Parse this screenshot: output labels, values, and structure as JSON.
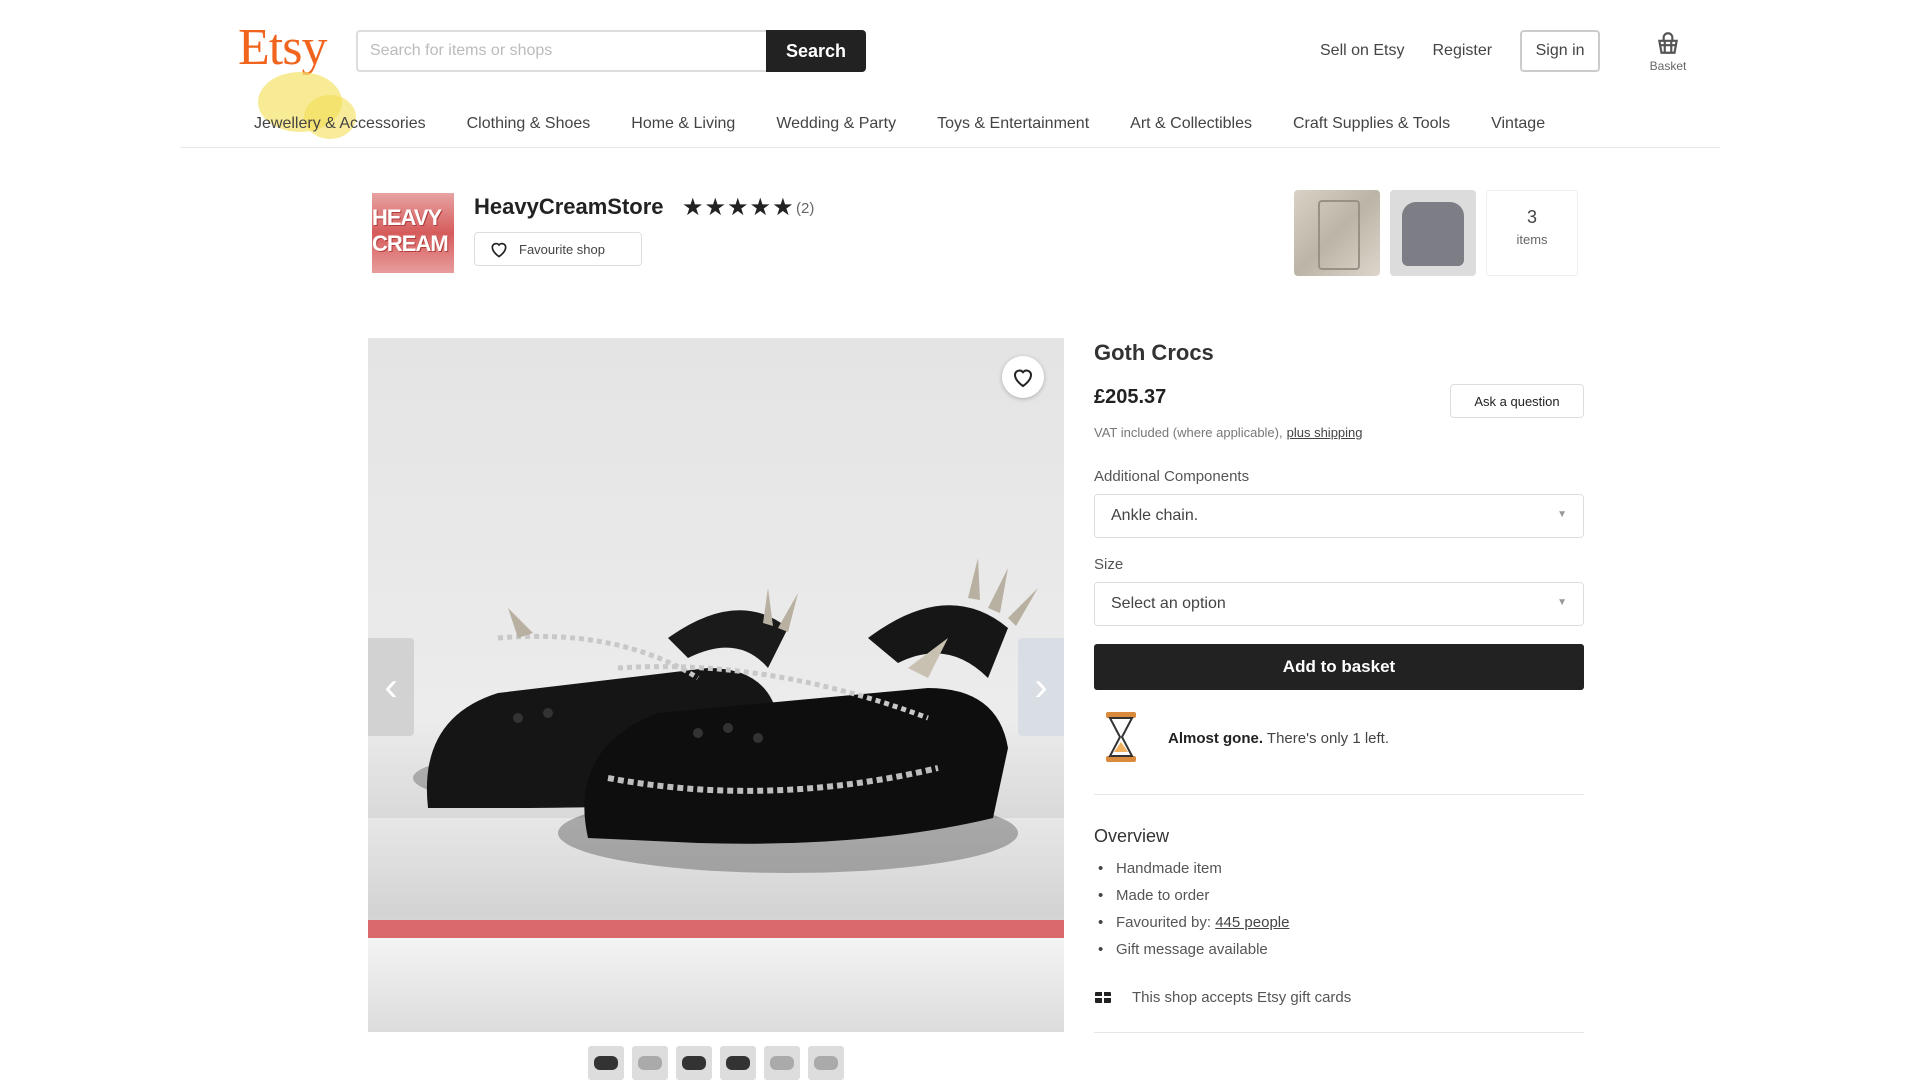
{
  "header": {
    "logo": "Etsy",
    "search": {
      "placeholder": "Search for items or shops",
      "button": "Search"
    },
    "links": {
      "sell": "Sell on Etsy",
      "register": "Register",
      "sign_in": "Sign in"
    },
    "basket_label": "Basket",
    "accent_color": "#f1641e"
  },
  "nav": {
    "items": [
      "Jewellery & Accessories",
      "Clothing & Shoes",
      "Home & Living",
      "Wedding & Party",
      "Toys & Entertainment",
      "Art & Collectibles",
      "Craft Supplies & Tools",
      "Vintage"
    ]
  },
  "shop": {
    "logo_lines": [
      "HEAVY",
      "CREAM"
    ],
    "name": "HeavyCreamStore",
    "stars": "★★★★★",
    "rating_count": "(2)",
    "favourite_label": "Favourite shop",
    "items_count": "3",
    "items_label": "items"
  },
  "product": {
    "title": "Goth Crocs",
    "price": "£205.37",
    "ask_question": "Ask a question",
    "vat_text": "VAT included (where applicable),",
    "vat_link": "plus shipping",
    "additional_components_label": "Additional Components",
    "additional_components_value": "Ankle chain.",
    "size_label": "Size",
    "size_value": "Select an option",
    "add_to_basket": "Add to basket",
    "scarcity_bold": "Almost gone.",
    "scarcity_text": "There's only 1 left.",
    "overview_title": "Overview",
    "overview_items": {
      "handmade": "Handmade item",
      "made_to_order": "Made to order",
      "favourited_prefix": "Favourited by:",
      "favourited_link": "445 people",
      "gift_message": "Gift message available"
    },
    "gift_cards": "This shop accepts Etsy gift cards"
  }
}
